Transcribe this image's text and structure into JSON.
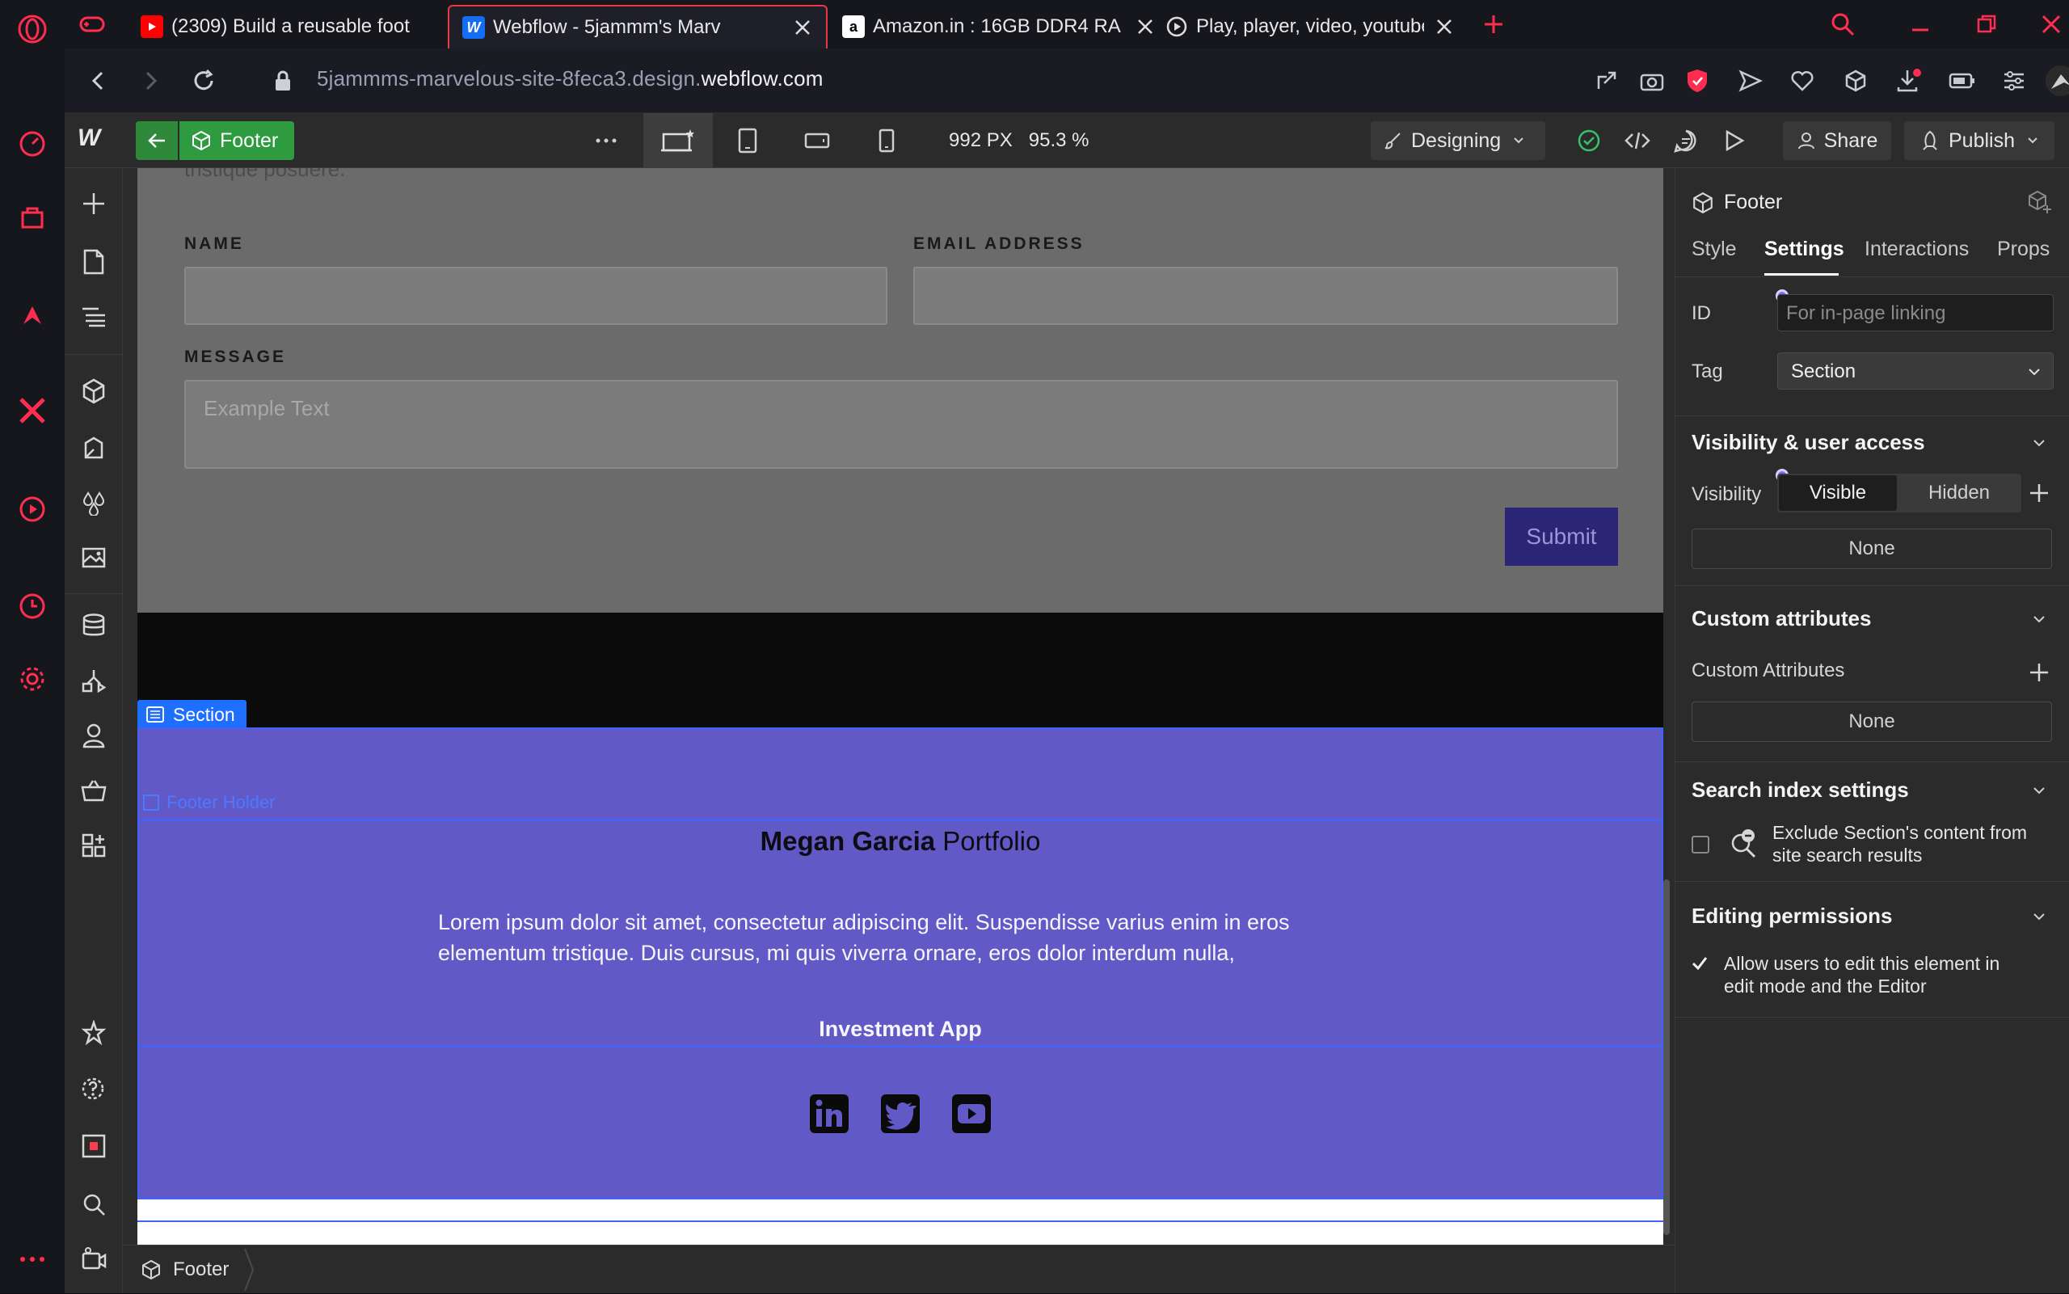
{
  "browser": {
    "tabs": [
      {
        "title": "(2309) Build a reusable foot",
        "favicon": "youtube-icon"
      },
      {
        "title": "Webflow - 5jammm's Marv",
        "favicon": "webflow-icon"
      },
      {
        "title": "Amazon.in : 16GB DDR4 RA",
        "favicon": "amazon-icon"
      },
      {
        "title": "Play, player, video, youtube",
        "favicon": "video-icon"
      }
    ],
    "url_prefix": "5jammms-marvelous-site-8feca3.design.",
    "url_domain": "webflow.com"
  },
  "webflow": {
    "logo": "W",
    "component_name": "Footer",
    "canvas_width": "992 PX",
    "zoom": "95.3 %",
    "mode_label": "Designing",
    "share_label": "Share",
    "publish_label": "Publish"
  },
  "canvas": {
    "top_text": "tristique posuere.",
    "form": {
      "name_label": "NAME",
      "email_label": "EMAIL ADDRESS",
      "message_label": "MESSAGE",
      "message_placeholder": "Example Text",
      "submit_label": "Submit"
    },
    "section_tag": "Section",
    "footer_holder_tag": "Footer Holder",
    "footer": {
      "name": "Megan Garcia",
      "portfolio": "Portfolio",
      "description": "Lorem ipsum dolor sit amet, consectetur adipiscing elit. Suspendisse varius enim in eros elementum tristique. Duis cursus, mi quis viverra ornare, eros dolor interdum nulla,",
      "app_link": "Investment App"
    },
    "breadcrumb": "Footer"
  },
  "panel": {
    "title": "Footer",
    "tabs": [
      "Style",
      "Settings",
      "Interactions",
      "Props"
    ],
    "active_tab": "Settings",
    "id_label": "ID",
    "id_placeholder": "For in-page linking",
    "tag_label": "Tag",
    "tag_value": "Section",
    "visibility_title": "Visibility & user access",
    "visibility_label": "Visibility",
    "visible_label": "Visible",
    "hidden_label": "Hidden",
    "visibility_none": "None",
    "custom_attr_title": "Custom attributes",
    "custom_attr_label": "Custom Attributes",
    "custom_attr_none": "None",
    "search_title": "Search index settings",
    "search_exclude_line1": "Exclude Section's content from",
    "search_exclude_line2": "site search results",
    "editing_title": "Editing permissions",
    "editing_line1": "Allow users to edit this element in",
    "editing_line2": "edit mode and the Editor"
  },
  "colors": {
    "footer_bg": "#6059c6",
    "accent_red": "#ff2d4f",
    "selection_blue": "#1f6fff",
    "component_green": "#2f9b40"
  }
}
